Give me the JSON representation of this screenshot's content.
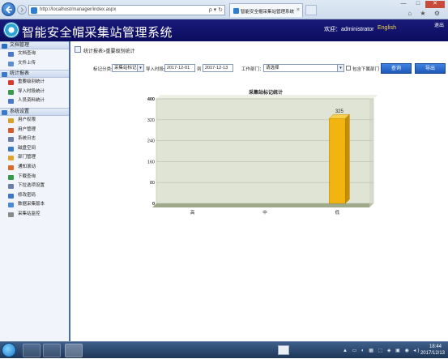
{
  "browser": {
    "url": "http://localhost/manager/index.aspx",
    "tab_title": "智能安全帽采集站管理系统",
    "tab_close": "×",
    "addr_tools": "ρ ▾ ↻",
    "win_minimize": "—",
    "win_maximize": "□",
    "win_close": "✕",
    "right_icons": "⌂ ★ ⚙"
  },
  "header": {
    "title": "智能安全帽采集站管理系统",
    "welcome": "欢迎：administrator",
    "lang": "English",
    "logout": "退出"
  },
  "sidebar": {
    "groups": [
      {
        "label": "文档管理",
        "icon": "folder-icon",
        "color": "#2b6cc4",
        "items": [
          {
            "label": "文档查询",
            "icon": "search-doc-icon",
            "color": "#4a79c8"
          },
          {
            "label": "文件上传",
            "icon": "upload-icon",
            "color": "#5a8fd4"
          }
        ]
      },
      {
        "label": "统计报表",
        "icon": "report-icon",
        "color": "#3a78c8",
        "items": [
          {
            "label": "重要级别统计",
            "icon": "star-icon",
            "color": "#d83a2a"
          },
          {
            "label": "导入时段统计",
            "icon": "time-chart-icon",
            "color": "#3a9a4a"
          },
          {
            "label": "人员资料统计",
            "icon": "person-icon",
            "color": "#4a79c8"
          }
        ]
      },
      {
        "label": "系统设置",
        "icon": "settings-icon",
        "color": "#3a78c8",
        "items": [
          {
            "label": "用户权限",
            "icon": "key-icon",
            "color": "#d8a32a"
          },
          {
            "label": "用户管理",
            "icon": "users-icon",
            "color": "#d85a2a"
          },
          {
            "label": "系统日志",
            "icon": "log-icon",
            "color": "#6a7fa8"
          },
          {
            "label": "磁盘空间",
            "icon": "disk-icon",
            "color": "#3a78c8"
          },
          {
            "label": "部门管理",
            "icon": "department-icon",
            "color": "#e0a52a"
          },
          {
            "label": "通知滚动",
            "icon": "notice-icon",
            "color": "#d86a2a"
          },
          {
            "label": "下载查询",
            "icon": "download-icon",
            "color": "#3a9a4a"
          },
          {
            "label": "下拉选项设置",
            "icon": "list-icon",
            "color": "#6a7fa8"
          },
          {
            "label": "修改密码",
            "icon": "password-icon",
            "color": "#3a78c8"
          },
          {
            "label": "数据采集版本",
            "icon": "version-icon",
            "color": "#4a8ad4"
          },
          {
            "label": "采集站监控",
            "icon": "monitor-icon",
            "color": "#8a8a8a"
          }
        ]
      }
    ]
  },
  "main": {
    "breadcrumb": "统计报表>重要级别统计",
    "filters": {
      "category_label": "标记分类:",
      "category_value": "采集站标记",
      "import_time_label": "导入时段:",
      "date_from": "2017-12-01",
      "to_label": "到",
      "date_to": "2017-12-13",
      "dept_label": "工作部门：",
      "dept_value": "请选择",
      "include_sub_label": "包含下属部门",
      "query_button": "查询",
      "export_button": "导出"
    }
  },
  "chart_data": {
    "type": "bar",
    "title": "采集站标记统计",
    "categories": [
      "高",
      "中",
      "低"
    ],
    "values": [
      0,
      0,
      325
    ],
    "ylim": [
      0,
      400
    ],
    "yticks": [
      0,
      80,
      160,
      240,
      320,
      400
    ],
    "grid": true,
    "bar_color": "#f2b410",
    "plot_bg": "#dfe4d5"
  },
  "taskbar": {
    "tray_icons": "▲ ▭ ◐ ▦ ⬚ ◈ ▣ ◉ ◂)",
    "time": "18:44",
    "date": "2017/12/13"
  }
}
